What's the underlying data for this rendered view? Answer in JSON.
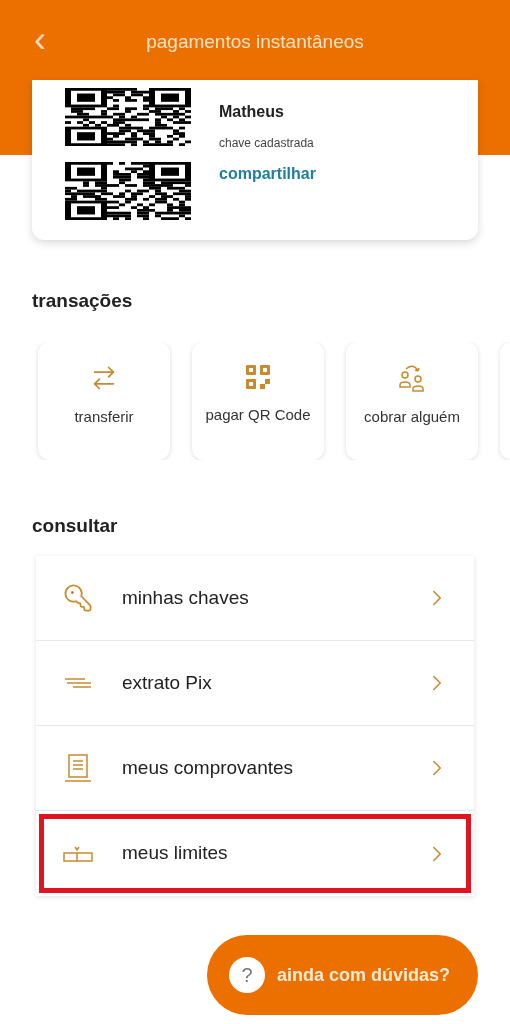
{
  "header": {
    "back": "‹",
    "title": "pagamentos instantâneos"
  },
  "key_card": {
    "name": "Matheus",
    "subtitle": "chave cadastrada",
    "share_link": "compartilhar"
  },
  "transactions": {
    "title": "transações",
    "items": [
      {
        "label": "transferir"
      },
      {
        "label": "pagar QR Code"
      },
      {
        "label": "cobrar alguém"
      }
    ]
  },
  "consult": {
    "title": "consultar",
    "items": [
      {
        "label": "minhas chaves",
        "highlighted": false
      },
      {
        "label": "extrato Pix",
        "highlighted": false
      },
      {
        "label": "meus comprovantes",
        "highlighted": false
      },
      {
        "label": "meus limites",
        "highlighted": true
      }
    ]
  },
  "help_button": {
    "icon": "?",
    "label": "ainda com dúvidas?"
  }
}
